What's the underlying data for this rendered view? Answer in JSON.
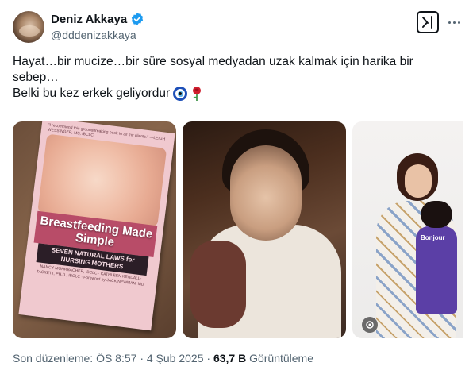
{
  "author": {
    "name": "Deniz Akkaya",
    "handle": "@dddenizakkaya",
    "verified": true,
    "verified_color": "#1d9bf0"
  },
  "post": {
    "line1": "Hayat…bir mucize…bir süre sosyal medyadan uzak kalmak için harika bir",
    "line2": "sebep…",
    "line3": "Belki bu kez  erkek geliyordur",
    "emojis": [
      "nazar-boncugu-icon",
      "rose-icon"
    ]
  },
  "media": {
    "book": {
      "quote": "\"I recommend this groundbreaking book to all my clients.\" —LEIGH WESSINGER, MS, IBCLC",
      "title": "Breastfeeding Made Simple",
      "subtitle": "SEVEN NATURAL LAWS for NURSING MOTHERS",
      "authors": "NANCY MOHRBACHER, IBCLC · KATHLEEN KENDALL-TACKETT, PH.D., IBCLC · Foreword by JACK NEWMAN, MD"
    },
    "kid_shirt_text": "Bonjour"
  },
  "footer": {
    "edited": "Son düzenleme: ÖS 8:57 · 4 Şub 2025 · ",
    "views_count": "63,7 B",
    "views_label": " Görüntüleme"
  }
}
